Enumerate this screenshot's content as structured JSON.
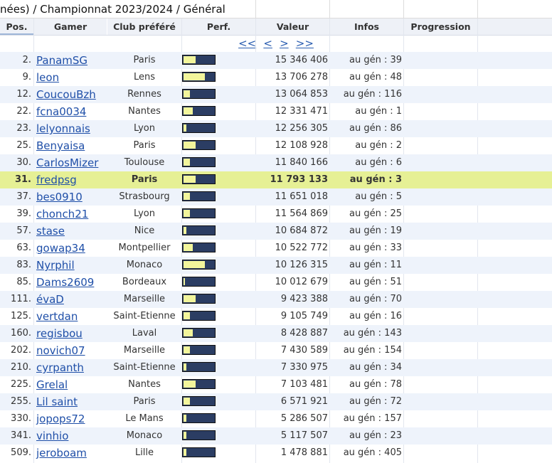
{
  "title": "nées) / Championnat 2023/2024 / Général",
  "headers": {
    "pos": "Pos.",
    "gamer": "Gamer",
    "club": "Club préféré",
    "perf": "Perf.",
    "valeur": "Valeur",
    "infos": "Infos",
    "progression": "Progression"
  },
  "nav": {
    "first": "<<",
    "prev": "<",
    "next": ">",
    "last": ">>"
  },
  "colors": {
    "header_bg": "#eef1f7",
    "alt_row": "#eef3fb",
    "highlight_row": "#e6f095",
    "bar_dark": "#2b3d63",
    "bar_fill": "#f2f59b",
    "link": "#1f4fa8"
  },
  "rows": [
    {
      "pos": "2.",
      "gamer": "PanamSG",
      "club": "Paris",
      "perf": 0.4,
      "valeur": "15 346 406",
      "infos": "au gén : 39"
    },
    {
      "pos": "9.",
      "gamer": "leon",
      "club": "Lens",
      "perf": 0.7,
      "valeur": "13 706 278",
      "infos": "au gén : 48"
    },
    {
      "pos": "12.",
      "gamer": "CoucouBzh",
      "club": "Rennes",
      "perf": 0.2,
      "valeur": "13 064 853",
      "infos": "au gén : 116"
    },
    {
      "pos": "22.",
      "gamer": "fcna0034",
      "club": "Nantes",
      "perf": 0.3,
      "valeur": "12 331 471",
      "infos": "au gén : 1"
    },
    {
      "pos": "23.",
      "gamer": "lelyonnais",
      "club": "Lyon",
      "perf": 0.1,
      "valeur": "12 256 305",
      "infos": "au gén : 86"
    },
    {
      "pos": "25.",
      "gamer": "Benyaisa",
      "club": "Paris",
      "perf": 0.4,
      "valeur": "12 108 928",
      "infos": "au gén : 2"
    },
    {
      "pos": "30.",
      "gamer": "CarlosMizer",
      "club": "Toulouse",
      "perf": 0.2,
      "valeur": "11 840 166",
      "infos": "au gén : 6"
    },
    {
      "pos": "31.",
      "gamer": "fredpsg",
      "club": "Paris",
      "perf": 0.4,
      "valeur": "11 793 133",
      "infos": "au gén : 3",
      "highlight": true
    },
    {
      "pos": "37.",
      "gamer": "bes0910",
      "club": "Strasbourg",
      "perf": 0.2,
      "valeur": "11 651 018",
      "infos": "au gén : 5"
    },
    {
      "pos": "39.",
      "gamer": "chonch21",
      "club": "Lyon",
      "perf": 0.2,
      "valeur": "11 564 869",
      "infos": "au gén : 25"
    },
    {
      "pos": "57.",
      "gamer": "stase",
      "club": "Nice",
      "perf": 0.1,
      "valeur": "10 684 872",
      "infos": "au gén : 19"
    },
    {
      "pos": "63.",
      "gamer": "gowap34",
      "club": "Montpellier",
      "perf": 0.3,
      "valeur": "10 522 772",
      "infos": "au gén : 33"
    },
    {
      "pos": "83.",
      "gamer": "Nyrphil",
      "club": "Monaco",
      "perf": 0.7,
      "valeur": "10 126 315",
      "infos": "au gén : 11"
    },
    {
      "pos": "85.",
      "gamer": "Dams2609",
      "club": "Bordeaux",
      "perf": 0.05,
      "valeur": "10 012 679",
      "infos": "au gén : 51"
    },
    {
      "pos": "111.",
      "gamer": "évaD",
      "club": "Marseille",
      "perf": 0.4,
      "valeur": "9 423 388",
      "infos": "au gén : 70"
    },
    {
      "pos": "125.",
      "gamer": "vertdan",
      "club": "Saint-Etienne",
      "perf": 0.2,
      "valeur": "9 105 749",
      "infos": "au gén : 16"
    },
    {
      "pos": "160.",
      "gamer": "regisbou",
      "club": "Laval",
      "perf": 0.3,
      "valeur": "8 428 887",
      "infos": "au gén : 143"
    },
    {
      "pos": "202.",
      "gamer": "novich07",
      "club": "Marseille",
      "perf": 0.2,
      "valeur": "7 430 589",
      "infos": "au gén : 154"
    },
    {
      "pos": "210.",
      "gamer": "cyrpanth",
      "club": "Saint-Etienne",
      "perf": 0.1,
      "valeur": "7 330 975",
      "infos": "au gén : 34"
    },
    {
      "pos": "225.",
      "gamer": "Grelal",
      "club": "Nantes",
      "perf": 0.4,
      "valeur": "7 103 481",
      "infos": "au gén : 78"
    },
    {
      "pos": "255.",
      "gamer": "Lil saint",
      "club": "Paris",
      "perf": 0.2,
      "valeur": "6 571 921",
      "infos": "au gén : 72"
    },
    {
      "pos": "330.",
      "gamer": "jopops72",
      "club": "Le Mans",
      "perf": 0.1,
      "valeur": "5 286 507",
      "infos": "au gén : 157"
    },
    {
      "pos": "341.",
      "gamer": "vinhio",
      "club": "Monaco",
      "perf": 0.1,
      "valeur": "5 117 507",
      "infos": "au gén : 23"
    },
    {
      "pos": "509.",
      "gamer": "jeroboam",
      "club": "Lille",
      "perf": 0.1,
      "valeur": "1 478 881",
      "infos": "au gén : 405"
    }
  ]
}
